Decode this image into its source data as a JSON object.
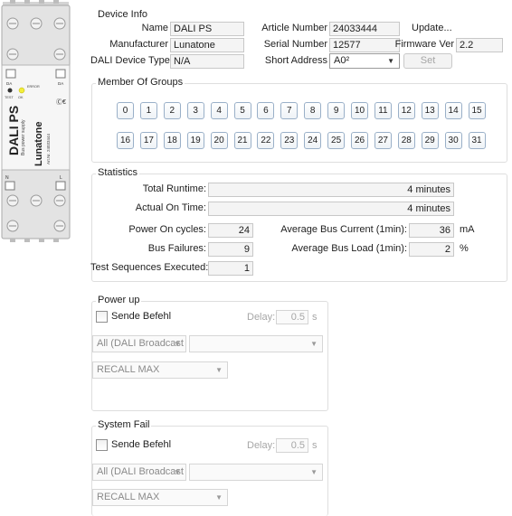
{
  "device_info": {
    "title": "Device Info",
    "name_label": "Name",
    "name_value": "DALI PS",
    "manufacturer_label": "Manufacturer",
    "manufacturer_value": "Lunatone",
    "device_type_label": "DALI Device Type",
    "device_type_value": "N/A",
    "article_label": "Article Number",
    "article_value": "24033444",
    "serial_label": "Serial Number",
    "serial_value": "12577",
    "short_address_label": "Short Address",
    "short_address_value": "A0²",
    "update_label": "Update...",
    "firmware_label": "Firmware Ver",
    "firmware_value": "2.2",
    "set_label": "Set"
  },
  "member_groups": {
    "title": "Member Of Groups",
    "groups": [
      "0",
      "1",
      "2",
      "3",
      "4",
      "5",
      "6",
      "7",
      "8",
      "9",
      "10",
      "11",
      "12",
      "13",
      "14",
      "15",
      "16",
      "17",
      "18",
      "19",
      "20",
      "21",
      "22",
      "23",
      "24",
      "25",
      "26",
      "27",
      "28",
      "29",
      "30",
      "31"
    ]
  },
  "statistics": {
    "title": "Statistics",
    "total_runtime_label": "Total Runtime:",
    "total_runtime_value": "4 minutes",
    "actual_on_label": "Actual On Time:",
    "actual_on_value": "4 minutes",
    "power_cycles_label": "Power On cycles:",
    "power_cycles_value": "24",
    "bus_failures_label": "Bus Failures:",
    "bus_failures_value": "9",
    "test_seq_label": "Test Sequences Executed:",
    "test_seq_value": "1",
    "avg_current_label": "Average Bus Current (1min):",
    "avg_current_value": "36",
    "avg_current_unit": "mA",
    "avg_load_label": "Average Bus Load (1min):",
    "avg_load_value": "2",
    "avg_load_unit": "%"
  },
  "power_up": {
    "title": "Power up",
    "send_label": "Sende Befehl",
    "delay_label": "Delay:",
    "delay_value": "0.5",
    "delay_unit": "s",
    "address_value": "All (DALI Broadcast",
    "target_value": "",
    "command_value": "RECALL MAX"
  },
  "system_fail": {
    "title": "System Fail",
    "send_label": "Sende Befehl",
    "delay_label": "Delay:",
    "delay_value": "0.5",
    "delay_unit": "s",
    "address_value": "All (DALI Broadcast",
    "target_value": "",
    "command_value": "RECALL MAX"
  },
  "device_image": {
    "brand": "Lunatone",
    "product": "DALI PS",
    "subtitle": "Bus power supply",
    "article": "Art.Nr. 24033444",
    "led_labels": [
      "TEST",
      "OK",
      "ERROR"
    ],
    "terminal_labels": [
      "DA",
      "DA",
      "N",
      "L"
    ]
  }
}
